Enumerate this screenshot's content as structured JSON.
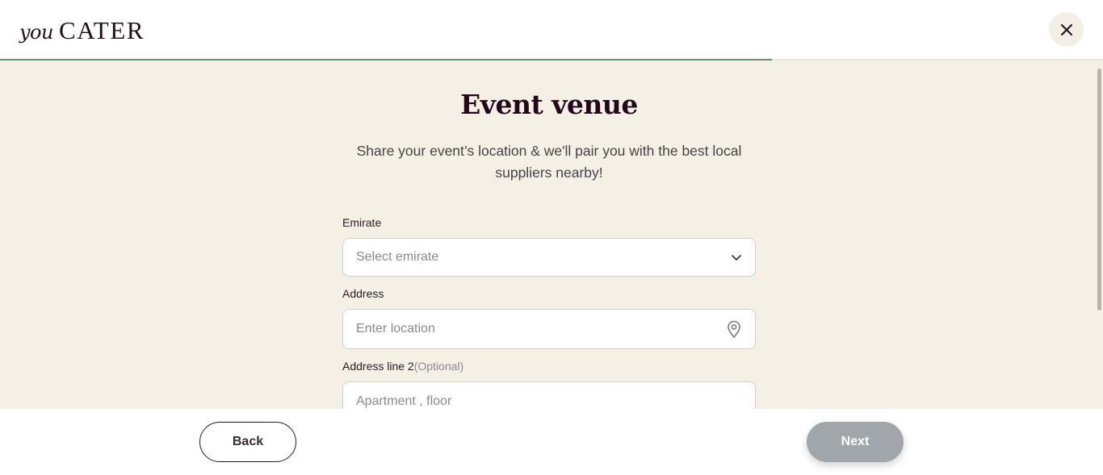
{
  "brand": {
    "logo_prefix": "you",
    "logo_name": "CATER"
  },
  "header": {
    "close_icon": "close-icon"
  },
  "progress": {
    "fraction": 0.7,
    "fill_color": "#6f8f6c"
  },
  "main": {
    "title": "Event venue",
    "subtitle": "Share your event’s location & we'll pair you with the best local suppliers nearby!"
  },
  "form": {
    "emirate": {
      "label": "Emirate",
      "placeholder": "Select emirate",
      "icon": "chevron-down-icon"
    },
    "address": {
      "label": "Address",
      "placeholder": "Enter location",
      "icon": "location-pin-icon"
    },
    "address_line2": {
      "label": "Address line 2",
      "optional": "(Optional)",
      "placeholder": "Apartment , floor"
    }
  },
  "footer": {
    "back_label": "Back",
    "next_label": "Next"
  },
  "colors": {
    "background": "#f5f0e6",
    "accent": "#6f8f6c",
    "next_disabled": "#a0a6a9",
    "title": "#22081a"
  }
}
